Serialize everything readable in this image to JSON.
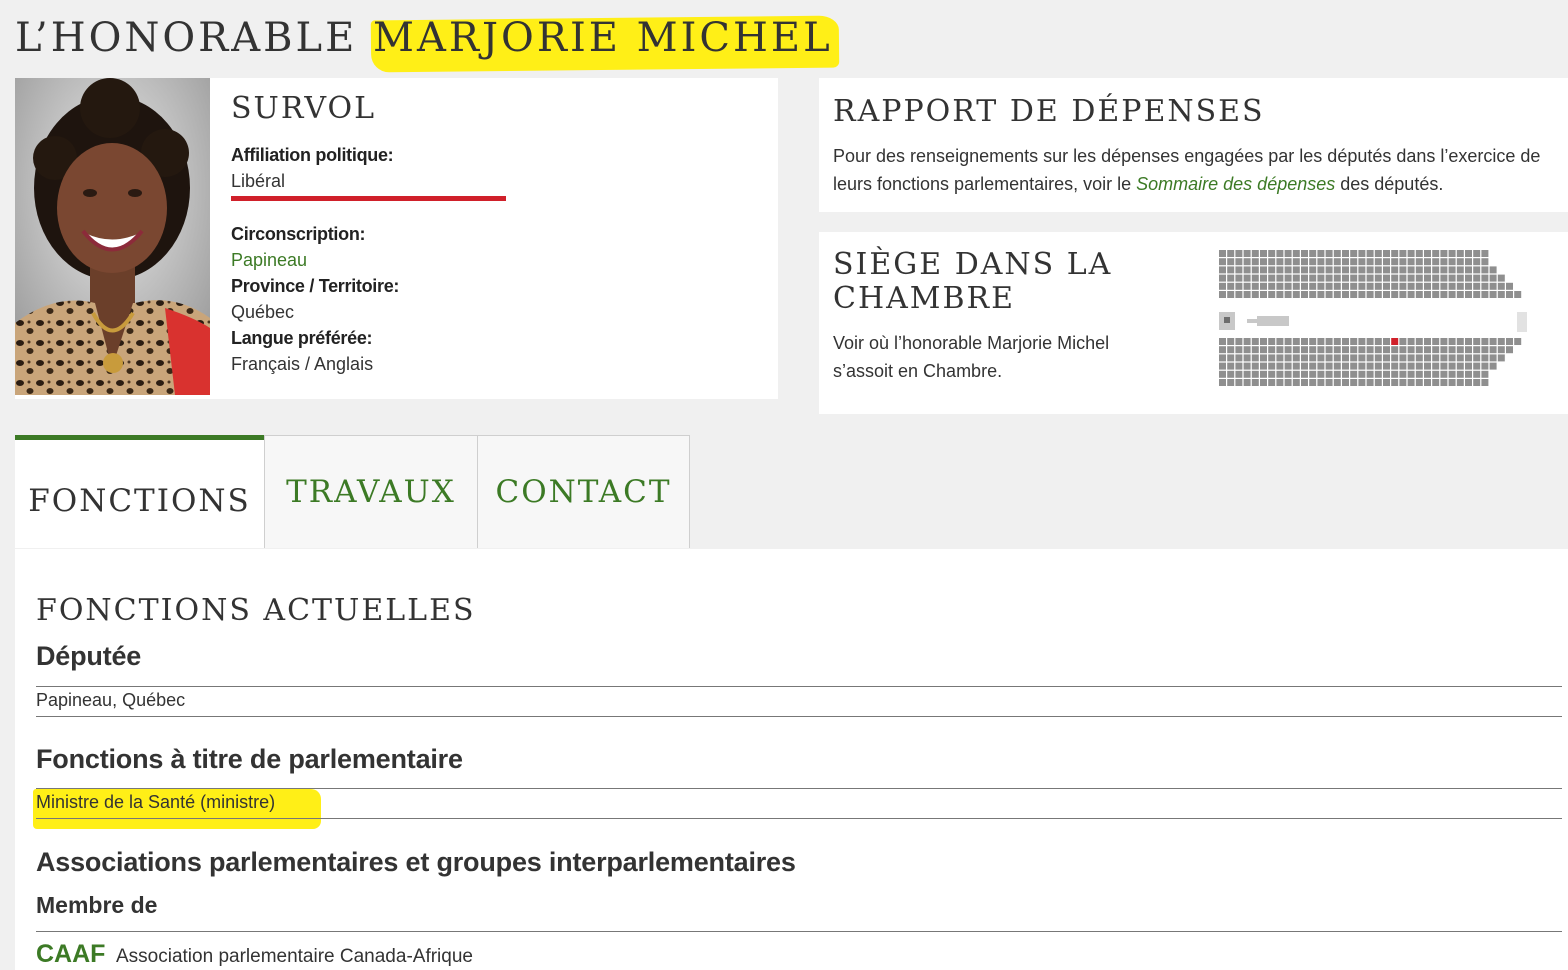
{
  "header": {
    "title_prefix": "L’HONORABLE",
    "title_name": "MARJORIE MICHEL"
  },
  "overview": {
    "heading": "SURVOL",
    "affiliation_label": "Affiliation politique:",
    "affiliation_value": "Libéral",
    "riding_label": "Circonscription:",
    "riding_value": "Papineau",
    "province_label": "Province / Territoire:",
    "province_value": "Québec",
    "language_label": "Langue préférée:",
    "language_value": "Français / Anglais",
    "party_color": "#d0202a"
  },
  "expenses": {
    "heading": "RAPPORT DE DÉPENSES",
    "text_before": "Pour des renseignements sur les dépenses engagées par les députés dans l’exercice de leurs fonctions parlementaires, voir le ",
    "link_text": "Sommaire des dépenses",
    "text_after": " des députés."
  },
  "seat": {
    "heading": "SIÈGE DANS LA CHAMBRE",
    "text": "Voir où l’honorable Marjorie Michel s’assoit en Chambre.",
    "highlight_color": "#d0202a",
    "seat_color": "#8f8f8f"
  },
  "tabs": [
    {
      "label": "FONCTIONS",
      "active": true
    },
    {
      "label": "TRAVAUX",
      "active": false
    },
    {
      "label": "CONTACT",
      "active": false
    }
  ],
  "roles": {
    "heading": "FONCTIONS ACTUELLES",
    "member_heading": "Députée",
    "member_value": "Papineau, Québec",
    "parl_heading": "Fonctions à titre de parlementaire",
    "parl_value": "Ministre de la Santé (ministre)",
    "assoc_heading": "Associations parlementaires et groupes interparlementaires",
    "member_of_label": "Membre de",
    "assoc_abbr": "CAAF",
    "assoc_name": "Association parlementaire Canada-Afrique"
  },
  "colors": {
    "accent_green": "#3c7a25",
    "highlight_yellow": "#ffef17",
    "background": "#f0f0f0"
  }
}
